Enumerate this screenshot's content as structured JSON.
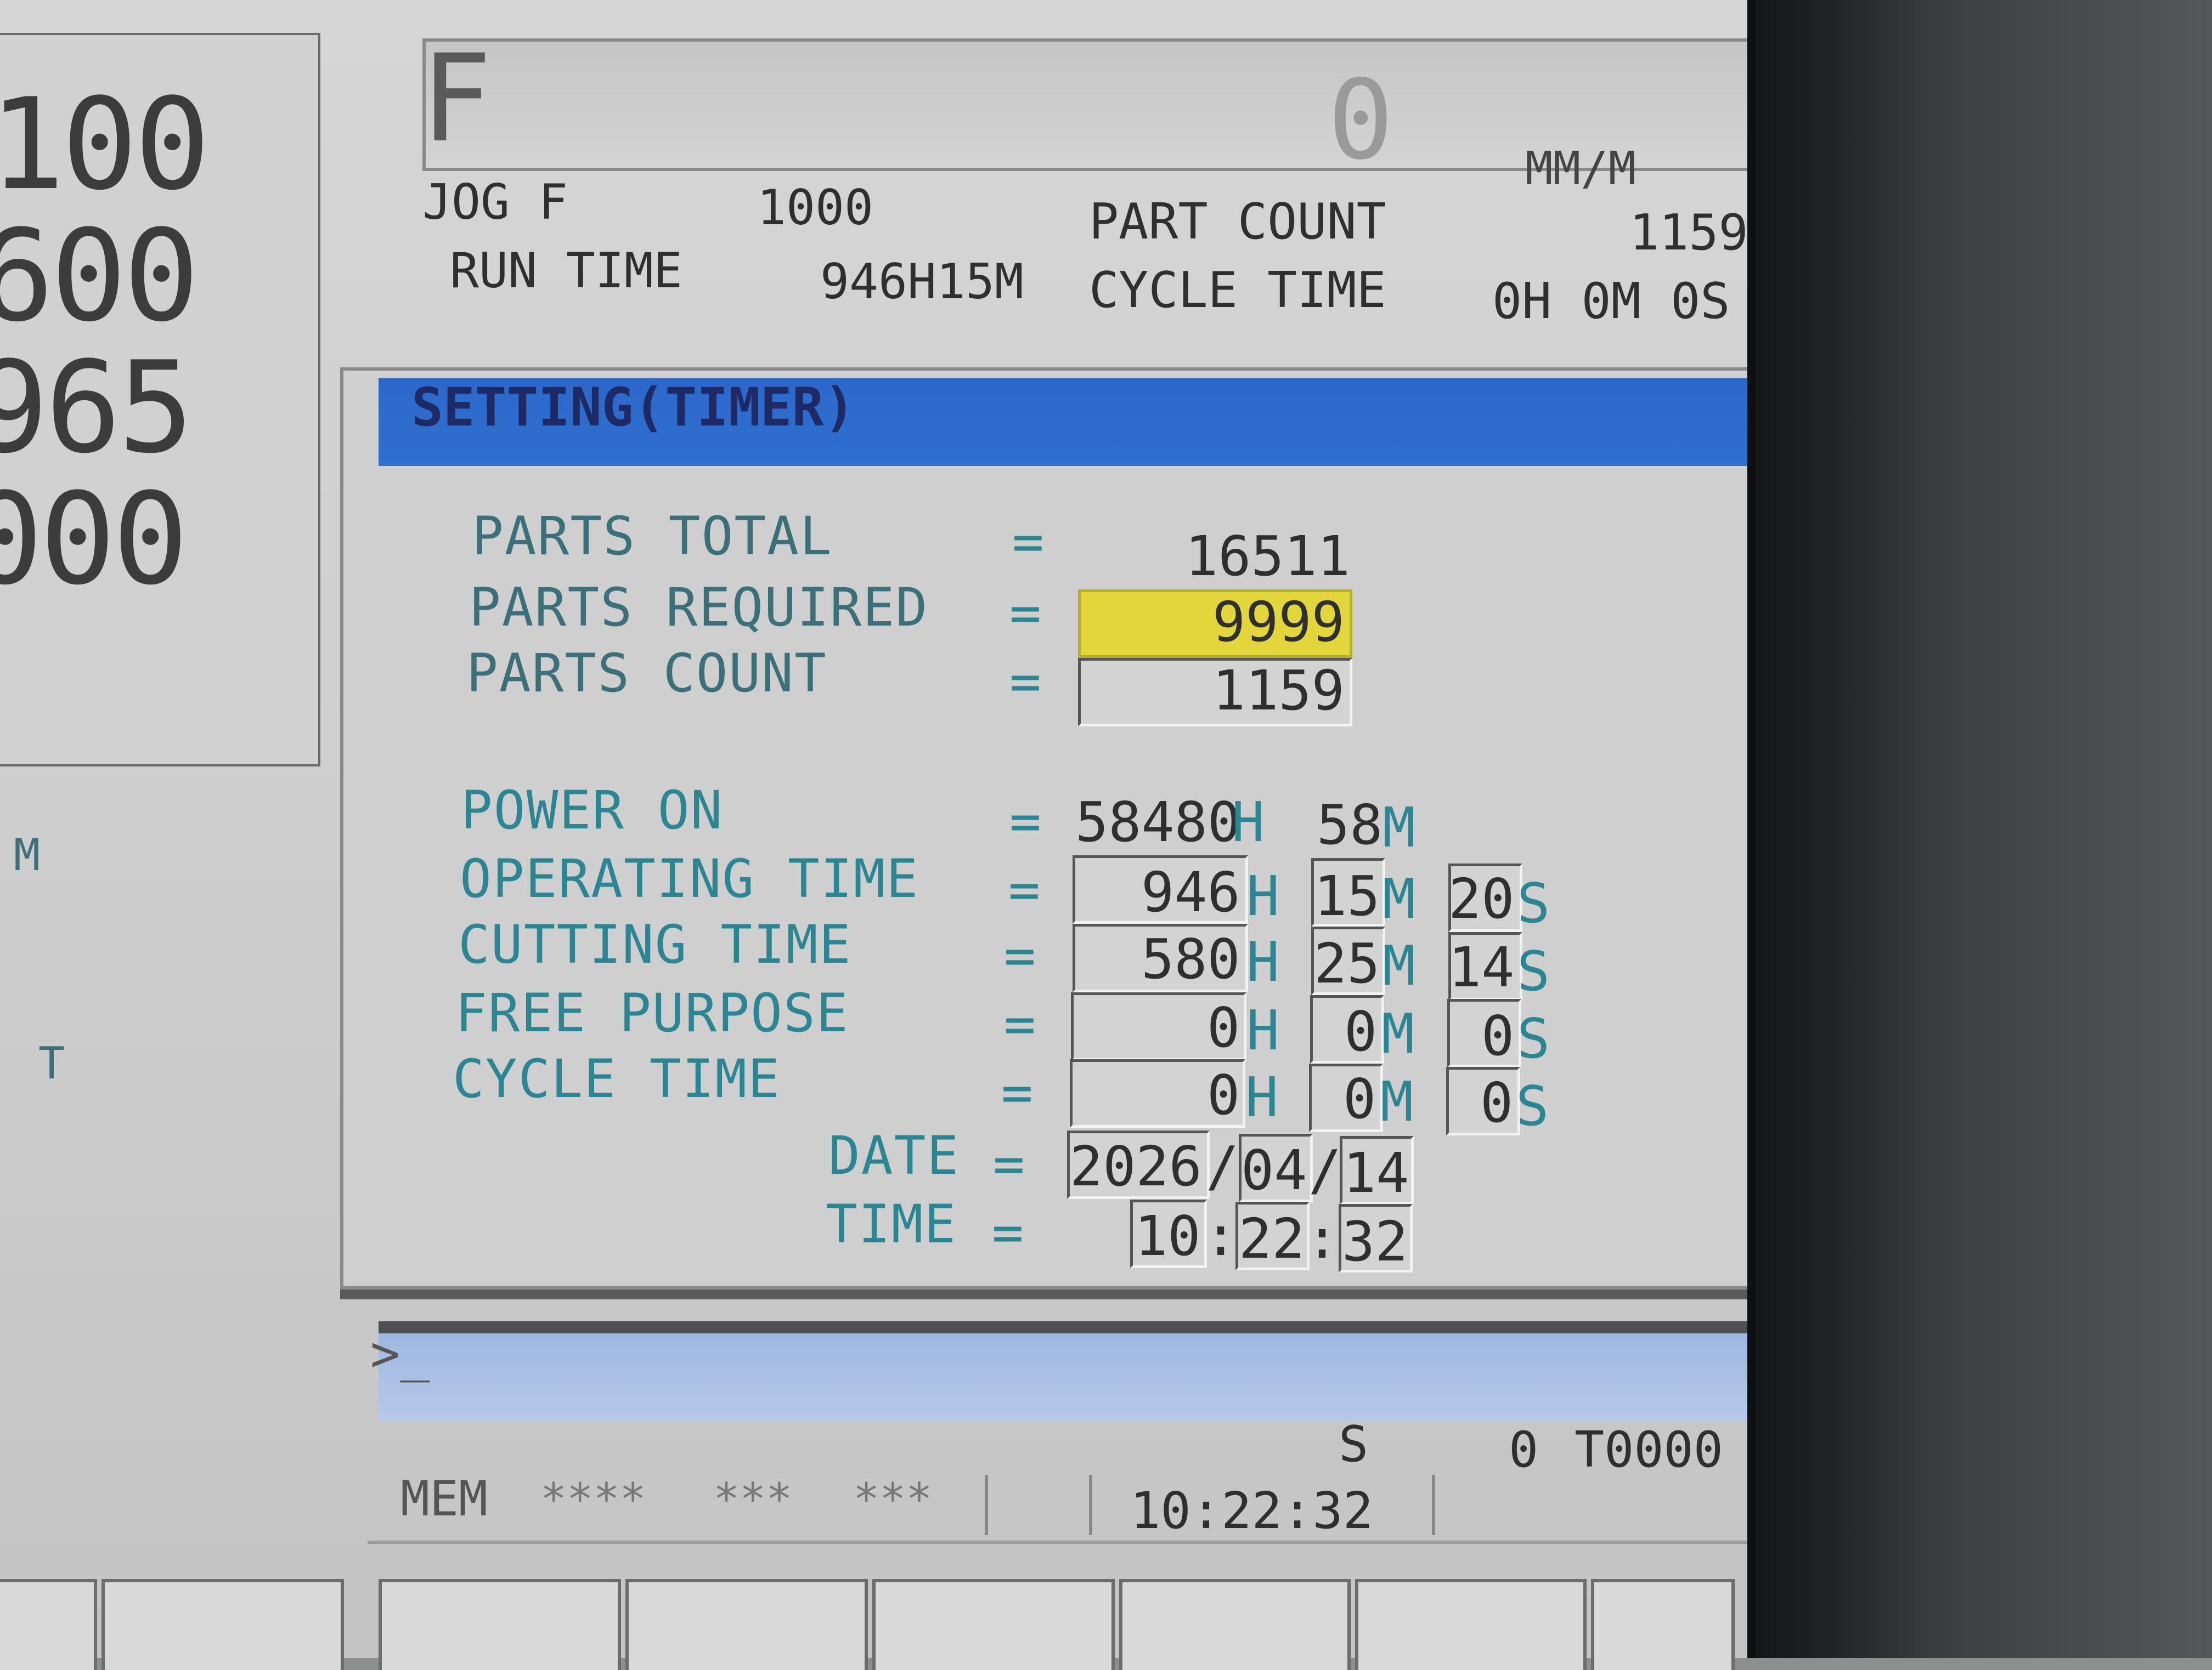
{
  "left_panel": {
    "values": [
      "100",
      "600",
      "965",
      "000"
    ],
    "axis_labels": [
      "M",
      "T"
    ]
  },
  "feed": {
    "letter": "F",
    "value": "0",
    "unit": "MM/M"
  },
  "header": {
    "jog_label": "JOG F",
    "jog_value": "1000",
    "part_count_label": "PART COUNT",
    "part_count_value": "1159",
    "run_time_label": "RUN TIME",
    "run_time_value": "946H15M",
    "cycle_time_label": "CYCLE TIME",
    "cycle_time_value": "0H 0M 0S"
  },
  "setting": {
    "title": "SETTING(TIMER)",
    "eq": "=",
    "parts_total_label": "PARTS TOTAL",
    "parts_total_value": "16511",
    "parts_required_label": "PARTS REQUIRED",
    "parts_required_value": "9999",
    "parts_count_label": "PARTS COUNT",
    "parts_count_value": "1159",
    "power_on_label": "POWER ON",
    "power_on_h": "58480",
    "power_on_m": "58",
    "operating_label": "OPERATING TIME",
    "operating_h": "946",
    "operating_m": "15",
    "operating_s": "20",
    "cutting_label": "CUTTING TIME",
    "cutting_h": "580",
    "cutting_m": "25",
    "cutting_s": "14",
    "free_label": "FREE PURPOSE",
    "free_h": "0",
    "free_m": "0",
    "free_s": "0",
    "cycle_label": "CYCLE TIME",
    "cycle_h": "0",
    "cycle_m": "0",
    "cycle_s": "0",
    "unit_h": "H",
    "unit_m": "M",
    "unit_s": "S",
    "date_label": "DATE",
    "date_year": "2026",
    "date_month": "04",
    "date_day": "14",
    "date_sep": "/",
    "time_label": "TIME",
    "time_h": "10",
    "time_m": "22",
    "time_s": "32",
    "time_sep": ":"
  },
  "command_line": {
    "prompt": ">_"
  },
  "status": {
    "spindle_label": "S",
    "spindle_value": "0",
    "tool": "T0000",
    "mode": "MEM",
    "stars1": "****",
    "stars2": "***",
    "stars3": "***",
    "clock": "10:22:32"
  },
  "colors": {
    "title_bar": "#2f6fd0",
    "label_text": "#2b8593",
    "highlight_field": "#e3d53c",
    "command_bar": "#b7c9ea"
  }
}
